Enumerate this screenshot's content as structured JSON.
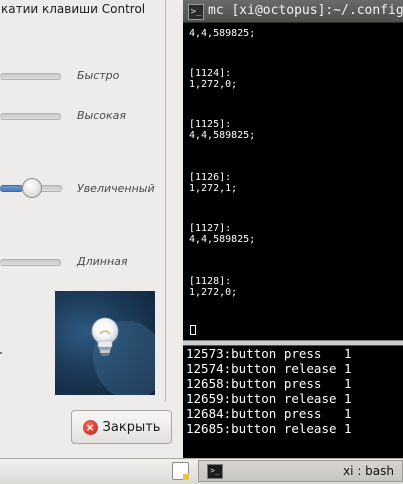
{
  "dialog": {
    "cut_label": "катии клавиши Control",
    "sliders": [
      {
        "label": "Быстро"
      },
      {
        "label": "Высокая"
      },
      {
        "label": "Увеличенный"
      },
      {
        "label": "Длинная"
      }
    ],
    "close_button": "Закрыть"
  },
  "terminal": {
    "title": "mc [xi@octopus]:~/.config",
    "mc_lines": [
      "4,4,589825;",
      "[1124]:",
      "1,272,0;",
      "[1125]:",
      "4,4,589825;",
      "[1126]:",
      "1,272,1;",
      "[1127]:",
      "4,4,589825;",
      "[1128]:",
      "1,272,0;"
    ],
    "xev_lines": [
      "12573:button press   1",
      "12574:button release 1",
      "12658:button press   1",
      "12659:button release 1",
      "12684:button press   1",
      "12685:button release 1"
    ]
  },
  "panel": {
    "task_label": "xi : bash"
  },
  "icons": {
    "close": "close-icon",
    "terminal": "terminal-icon",
    "document": "document-icon",
    "lightbulb": "lightbulb-icon"
  }
}
